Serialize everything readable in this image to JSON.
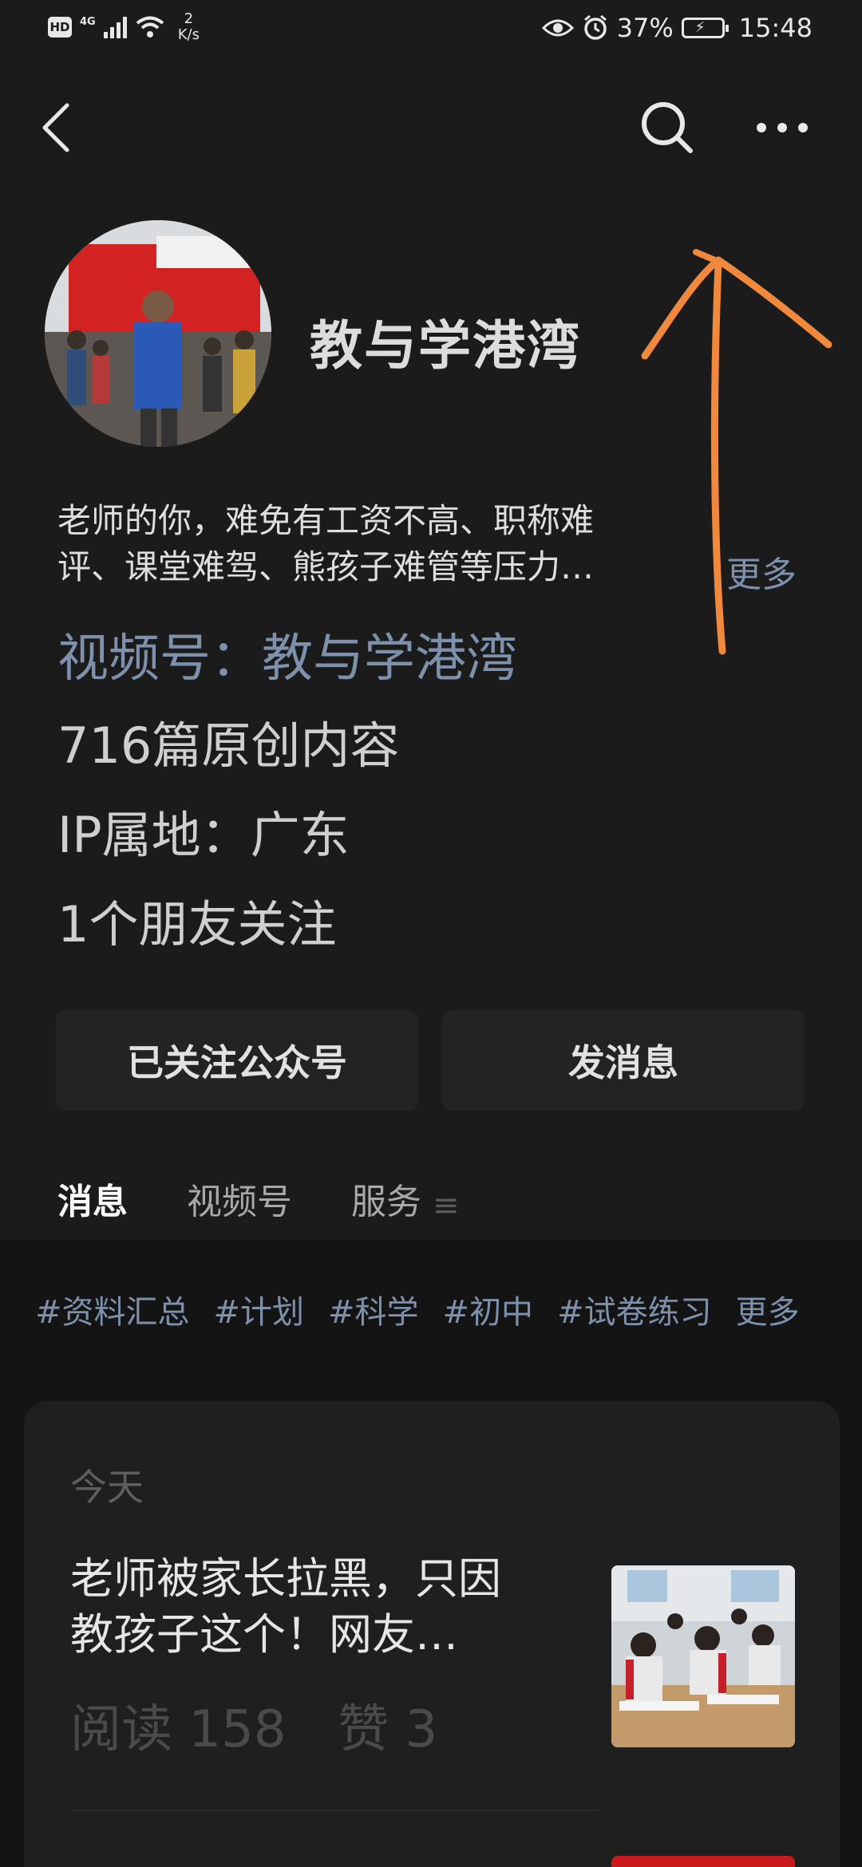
{
  "status_bar": {
    "hd": "HD",
    "network": "4G",
    "speed_value": "2",
    "speed_unit": "K/s",
    "battery": "37%",
    "time": "15:48"
  },
  "nav": {
    "back_icon": "back-arrow-icon",
    "search_icon": "search-icon",
    "more_icon": "more-dots-icon"
  },
  "profile": {
    "name": "教与学港湾",
    "bio_line1": "老师的你，难免有工资不高、职称难",
    "bio_line2": "评、课堂难驾、熊孩子难管等压力…",
    "bio_more": "更多",
    "channel": "视频号：教与学港湾",
    "original_count": "716篇原创内容",
    "ip_location": "IP属地：广东",
    "friends_following": "1个朋友关注"
  },
  "actions": {
    "followed": "已关注公众号",
    "message": "发消息"
  },
  "tabs": {
    "items": [
      "消息",
      "视频号",
      "服务"
    ],
    "more_glyph": "≡"
  },
  "tags": [
    "#资料汇总",
    "#计划",
    "#科学",
    "#初中",
    "#试卷练习",
    "更多"
  ],
  "feed": {
    "date": "今天",
    "article_title_line1": "老师被家长拉黑，只因",
    "article_title_line2": "教孩子这个！网友…",
    "read_label": "阅读",
    "read_count": "158",
    "like_label": "赞",
    "like_count": "3"
  },
  "colors": {
    "background": "#1b1b1b",
    "link_blue": "#7d91ad",
    "annotation_orange": "#f0893c"
  }
}
